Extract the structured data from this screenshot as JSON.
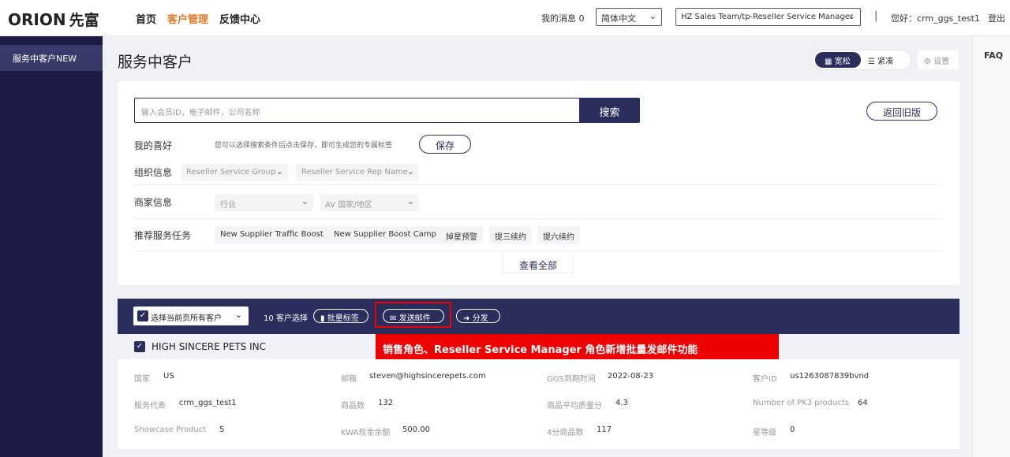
{
  "header": {
    "logo_text": "ORION",
    "logo_cn": "先富",
    "nav": [
      "首页",
      "客户管理",
      "反馈中心"
    ],
    "active_nav": "客户管理",
    "messages": "我的消息 0",
    "language": "简体中文",
    "team": "HZ Sales Team/tp-Reseller Service Manager",
    "separator": "|",
    "greeting": "您好：crm_ggs_test1",
    "logout": "登出"
  },
  "sidebar": {
    "items": [
      "服务中客户NEW"
    ]
  },
  "faq": "FAQ",
  "page": {
    "title": "服务中客户",
    "view_wide": "宽松",
    "view_compact": "紧凑",
    "settings": "设置"
  },
  "search": {
    "placeholder": "输入会员ID，电子邮件，公司名称",
    "button": "搜索",
    "back_button": "返回旧版"
  },
  "filters": {
    "favorites_label": "我的喜好",
    "favorites_hint": "您可以选择搜索条件后点击保存，即可生成您的专属标签",
    "save_button": "保存",
    "org_label": "组织信息",
    "org_dropdowns": [
      "Reseller Service Group",
      "Reseller Service Rep Name"
    ],
    "merchant_label": "商家信息",
    "merchant_dropdowns": [
      "行业",
      "AV 国家/地区"
    ],
    "tasks_label": "推荐服务任务",
    "task_tags": [
      "New Supplier Traffic Boost",
      "New Supplier Boost Camp",
      "掉星预警",
      "提三续约",
      "提六续约"
    ],
    "view_all": "查看全部"
  },
  "actionbar": {
    "select_all": "选择当前页所有客户",
    "count": "10 客户选择",
    "batch_tag": "批量标签",
    "send_email": "发送邮件",
    "distribute": "分发"
  },
  "annotation": "销售角色、Reseller Service Manager 角色新增批量发邮件功能",
  "result": {
    "company": "HIGH SINCERE PETS INC",
    "fields": [
      {
        "label": "国家",
        "value": "US"
      },
      {
        "label": "邮箱",
        "value": "steven@highsincerepets.com"
      },
      {
        "label": "GGS到期时间",
        "value": "2022-08-23"
      },
      {
        "label": "客户ID",
        "value": "us1263087839bvnd"
      },
      {
        "label": "服务代表",
        "value": "crm_ggs_test1"
      },
      {
        "label": "商品数",
        "value": "132"
      },
      {
        "label": "商品平均质量分",
        "value": "4.3"
      },
      {
        "label": "Number of PK3 products",
        "value": "64"
      },
      {
        "label": "Showcase Product",
        "value": "5"
      },
      {
        "label": "KWA现金余额",
        "value": "500.00"
      },
      {
        "label": "4分商品数",
        "value": "117"
      },
      {
        "label": "星等级",
        "value": "0"
      }
    ]
  }
}
